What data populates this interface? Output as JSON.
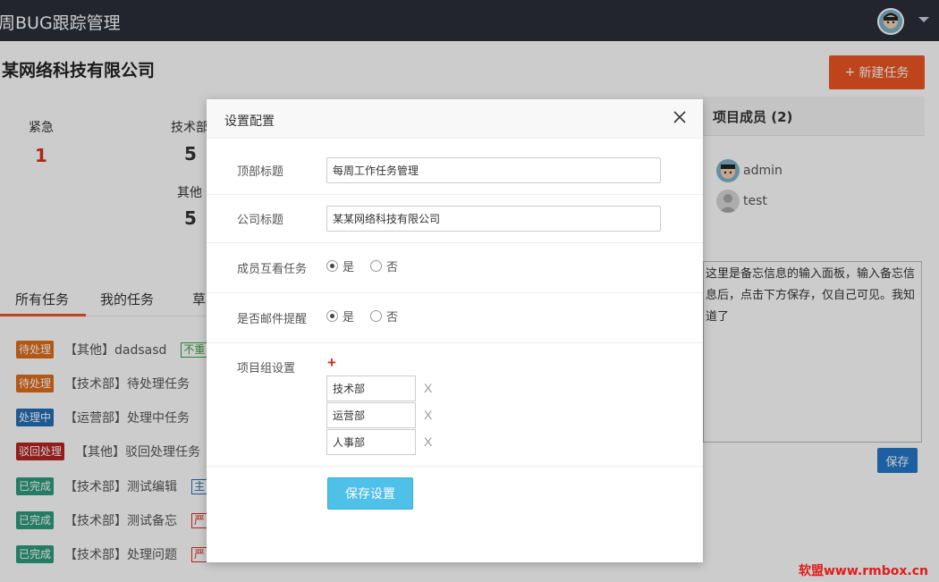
{
  "header": {
    "title": "周BUG跟踪管理"
  },
  "company": {
    "name": "某网络科技有限公司",
    "new_task_label": "新建任务"
  },
  "stats": {
    "urgent_label": "紧急",
    "urgent_value": "1",
    "dept1_label": "技术部",
    "dept1_value": "5",
    "dept2_label": "其他",
    "dept2_value": "5"
  },
  "members": {
    "title": "项目成员 (2)",
    "list": [
      {
        "name": "admin"
      },
      {
        "name": "test"
      }
    ]
  },
  "memo": {
    "text": "这里是备忘信息的输入面板，输入备忘信息后，点击下方保存，仅自己可见。我知道了",
    "save_label": "保存"
  },
  "tabs": {
    "all": "所有任务",
    "mine": "我的任务",
    "draft": "草"
  },
  "tasks": [
    {
      "status": "待处理",
      "status_color": "#e06d1a",
      "title": "【其他】dadsasd",
      "tag": "不重",
      "tag_color": "#3aa04a"
    },
    {
      "status": "待处理",
      "status_color": "#e06d1a",
      "title": "【技术部】待处理任务"
    },
    {
      "status": "处理中",
      "status_color": "#2470b8",
      "title": "【运营部】处理中任务"
    },
    {
      "status": "驳回处理",
      "status_color": "#b82525",
      "title": "【其他】驳回处理任务"
    },
    {
      "status": "已完成",
      "status_color": "#2e9c7c",
      "title": "【技术部】测试编辑",
      "tag": "主",
      "tag_color": "#2470b8"
    },
    {
      "status": "已完成",
      "status_color": "#2e9c7c",
      "title": "【技术部】测试备忘",
      "tag": "严",
      "tag_color": "#d9301d"
    },
    {
      "status": "已完成",
      "status_color": "#2e9c7c",
      "title": "【技术部】处理问题",
      "tag": "严",
      "tag_color": "#d9301d"
    }
  ],
  "watermark": "软盟www.rmbox.cn",
  "modal": {
    "title": "设置配置",
    "top_title_label": "顶部标题",
    "top_title_value": "每周工作任务管理",
    "company_title_label": "公司标题",
    "company_title_value": "某某网络科技有限公司",
    "mutual_view_label": "成员互看任务",
    "email_remind_label": "是否邮件提醒",
    "yes_label": "是",
    "no_label": "否",
    "mutual_view_selected": "是",
    "email_remind_selected": "是",
    "group_label": "项目组设置",
    "add_symbol": "+",
    "delete_symbol": "X",
    "groups": [
      "技术部",
      "运营部",
      "人事部"
    ],
    "save_label": "保存设置"
  },
  "colors": {
    "topbar": "#2b2f3a",
    "accent": "#ee5622",
    "primary": "#2579cb",
    "save_settings": "#4fc0e8"
  },
  "icons": {
    "close": "close-icon",
    "caret": "chevron-down-icon",
    "avatar": "avatar-icon"
  }
}
